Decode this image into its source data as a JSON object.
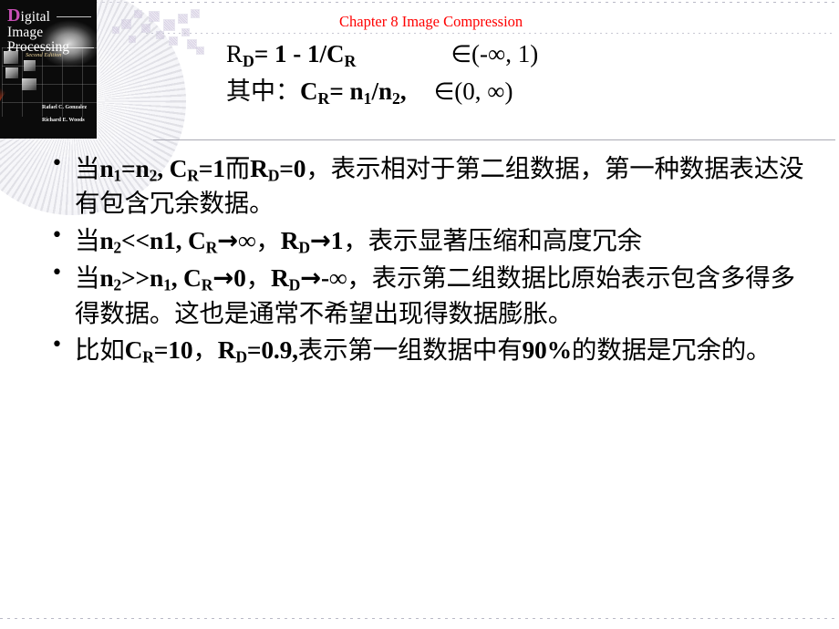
{
  "slide": {
    "header": {
      "chapter_title": "Chapter 8  Image Compression",
      "title_color": "#ff0000"
    },
    "book_cover": {
      "title_line1_drop": "D",
      "title_line1_rest": "igital",
      "title_line2": "Image",
      "title_line3": "Processing",
      "edition": "Second Edition",
      "author1": "Rafael C. Gonzalez",
      "author2": "Richard E. Woods"
    },
    "formula": {
      "line1": {
        "lhs_main": "R",
        "lhs_sub": "D",
        "eq": "= 1 - 1/C",
        "eq_sub": "R",
        "member_symbol": "∈",
        "range": "(-∞, 1)"
      },
      "line2": {
        "prefix": "其中：",
        "lhs_main": "C",
        "lhs_sub": "R",
        "eq": "= n",
        "num_sub": "1",
        "slash": "/n",
        "den_sub": "2",
        "comma": ",",
        "member_symbol": "∈",
        "range": "(0, ∞)"
      }
    },
    "bullets": [
      {
        "id": "bullet-equal-case",
        "segments": [
          {
            "t": "han",
            "v": "当"
          },
          {
            "t": "var",
            "v": "n"
          },
          {
            "t": "sub",
            "v": "1"
          },
          {
            "t": "var",
            "v": "=n"
          },
          {
            "t": "sub",
            "v": "2"
          },
          {
            "t": "var",
            "v": ", C"
          },
          {
            "t": "sub",
            "v": "R"
          },
          {
            "t": "var",
            "v": "=1"
          },
          {
            "t": "han",
            "v": "而"
          },
          {
            "t": "var",
            "v": "R"
          },
          {
            "t": "sub",
            "v": "D"
          },
          {
            "t": "var",
            "v": "=0"
          },
          {
            "t": "han",
            "v": "，表示相对于第二组数据，第一种数据表达没有包含冗余数据。"
          }
        ]
      },
      {
        "id": "bullet-high-compression-case",
        "segments": [
          {
            "t": "han",
            "v": "当"
          },
          {
            "t": "var",
            "v": "n"
          },
          {
            "t": "sub",
            "v": "2"
          },
          {
            "t": "var",
            "v": "<<n1, C"
          },
          {
            "t": "sub",
            "v": "R"
          },
          {
            "t": "arr",
            "v": "→"
          },
          {
            "t": "var",
            "v": "∞"
          },
          {
            "t": "han",
            "v": "，"
          },
          {
            "t": "var",
            "v": "R"
          },
          {
            "t": "sub",
            "v": "D"
          },
          {
            "t": "arr",
            "v": "→"
          },
          {
            "t": "var",
            "v": "1"
          },
          {
            "t": "han",
            "v": "，表示显著压缩和高度冗余"
          }
        ]
      },
      {
        "id": "bullet-expansion-case",
        "segments": [
          {
            "t": "han",
            "v": "当"
          },
          {
            "t": "var",
            "v": "n"
          },
          {
            "t": "sub",
            "v": "2"
          },
          {
            "t": "var",
            "v": ">>n"
          },
          {
            "t": "sub",
            "v": "1"
          },
          {
            "t": "var",
            "v": ", C"
          },
          {
            "t": "sub",
            "v": "R"
          },
          {
            "t": "arr",
            "v": "→"
          },
          {
            "t": "var",
            "v": "0"
          },
          {
            "t": "han",
            "v": "，"
          },
          {
            "t": "var",
            "v": "R"
          },
          {
            "t": "sub",
            "v": "D"
          },
          {
            "t": "arr",
            "v": "→"
          },
          {
            "t": "var",
            "v": "-∞"
          },
          {
            "t": "han",
            "v": "，表示第二组数据比原始表示包含多得多得数据。这也是通常不希望出现得数据膨胀。"
          }
        ]
      },
      {
        "id": "bullet-example-case",
        "segments": [
          {
            "t": "han",
            "v": "比如"
          },
          {
            "t": "var",
            "v": "C"
          },
          {
            "t": "sub",
            "v": "R"
          },
          {
            "t": "var",
            "v": "=10"
          },
          {
            "t": "han",
            "v": "，"
          },
          {
            "t": "var",
            "v": "R"
          },
          {
            "t": "sub",
            "v": "D"
          },
          {
            "t": "var",
            "v": "=0.9,"
          },
          {
            "t": "han",
            "v": "表示第一组数据中有"
          },
          {
            "t": "var",
            "v": "90%"
          },
          {
            "t": "han",
            "v": "的数据是冗余的。"
          }
        ]
      }
    ]
  }
}
